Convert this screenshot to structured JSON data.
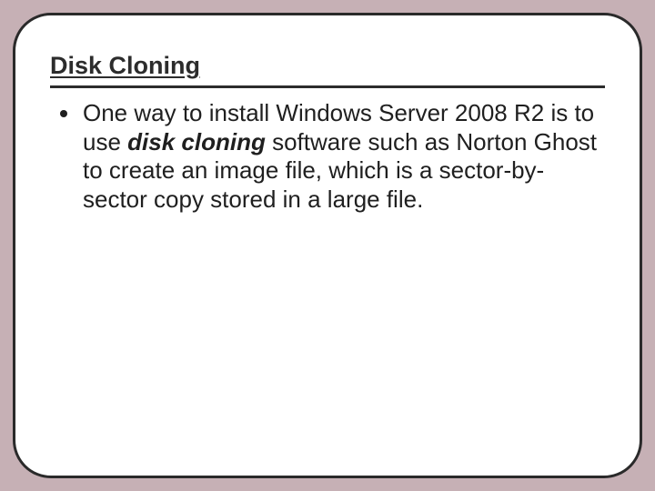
{
  "slide": {
    "title": "Disk Cloning",
    "bullet1": {
      "part1": "One way to install Windows Server 2008 R2 is to use ",
      "emph": "disk cloning",
      "part2": " software such as Norton Ghost to create an image file, which is a sector-by-sector copy stored in a large file."
    }
  }
}
